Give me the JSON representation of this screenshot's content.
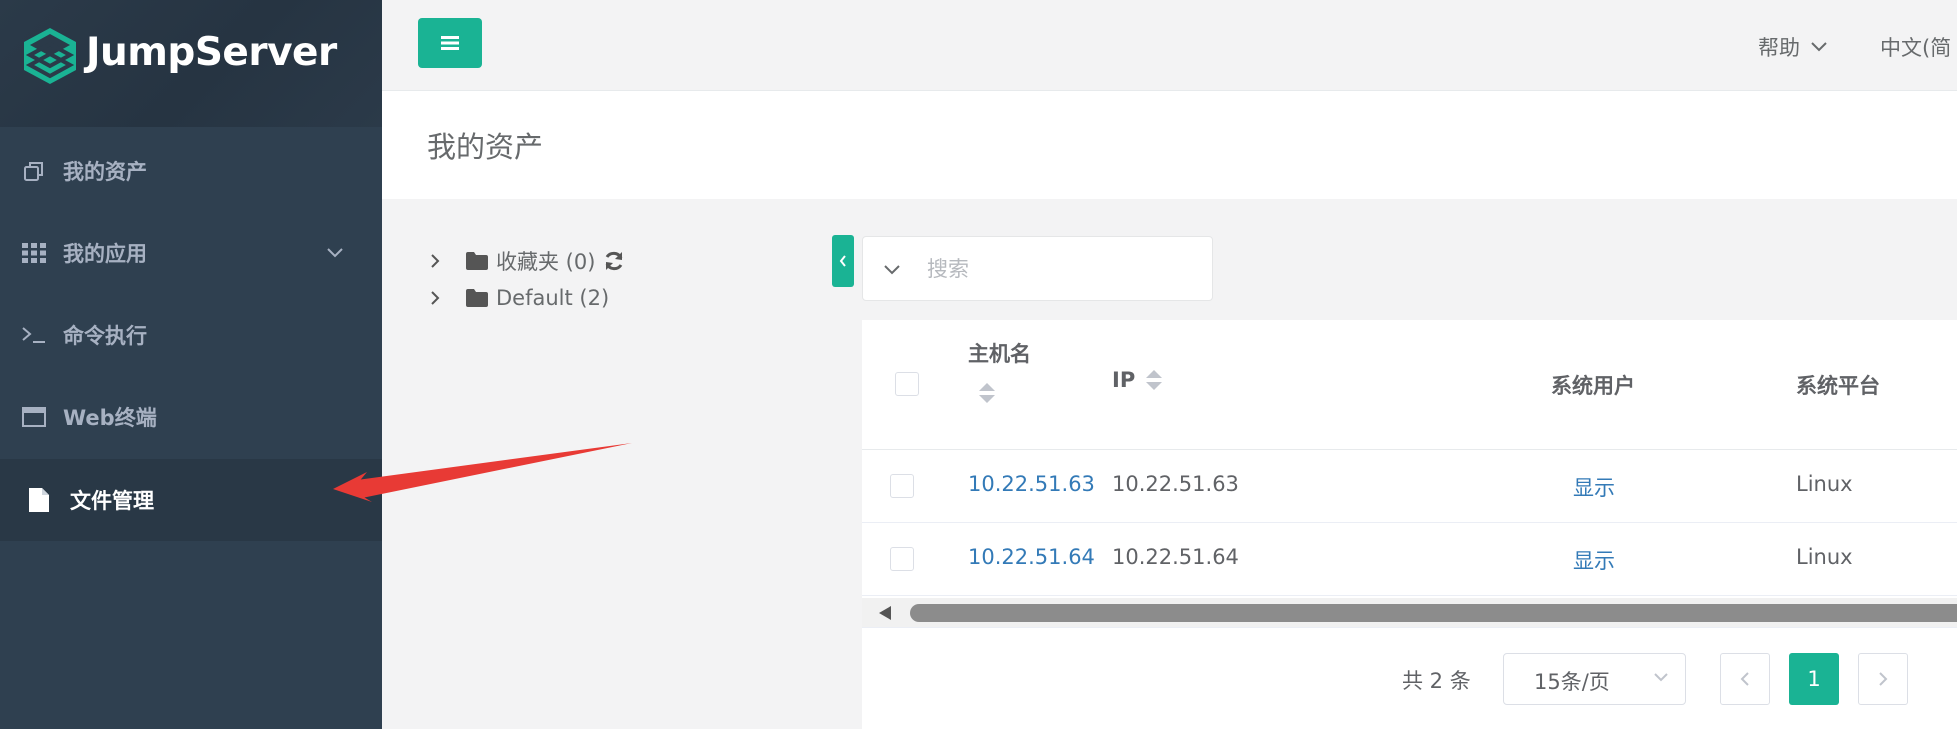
{
  "app": {
    "brand": "JumpServer",
    "accent": "#1ab394",
    "sidebar_bg": "#2f4050"
  },
  "sidebar": {
    "items": [
      {
        "label": "我的资产",
        "icon": "assets-icon"
      },
      {
        "label": "我的应用",
        "icon": "grid-icon",
        "has_submenu": true
      },
      {
        "label": "命令执行",
        "icon": "terminal-prompt-icon"
      },
      {
        "label": "Web终端",
        "icon": "window-icon"
      },
      {
        "label": "文件管理",
        "icon": "file-icon",
        "active": true
      }
    ]
  },
  "header": {
    "help_label": "帮助",
    "language_label": "中文(简"
  },
  "page": {
    "title": "我的资产"
  },
  "tree": {
    "nodes": [
      {
        "label": "收藏夹 (0)",
        "icon": "folder-icon",
        "has_refresh": true
      },
      {
        "label": "Default (2)",
        "icon": "folder-icon"
      }
    ]
  },
  "search": {
    "placeholder": "搜索",
    "value": ""
  },
  "table": {
    "columns": [
      {
        "label": "主机名",
        "sortable": true
      },
      {
        "label": "IP",
        "sortable": true
      },
      {
        "label": "系统用户",
        "sortable": false
      },
      {
        "label": "系统平台",
        "sortable": false
      }
    ],
    "rows": [
      {
        "hostname": "10.22.51.63",
        "ip": "10.22.51.63",
        "system_user": "显示",
        "platform": "Linux"
      },
      {
        "hostname": "10.22.51.64",
        "ip": "10.22.51.64",
        "system_user": "显示",
        "platform": "Linux"
      }
    ]
  },
  "pagination": {
    "total_label": "共 2 条",
    "page_size": "15条/页",
    "current_page": "1"
  },
  "annotation": {
    "arrow_color": "#e83a35",
    "points_to": "文件管理"
  }
}
